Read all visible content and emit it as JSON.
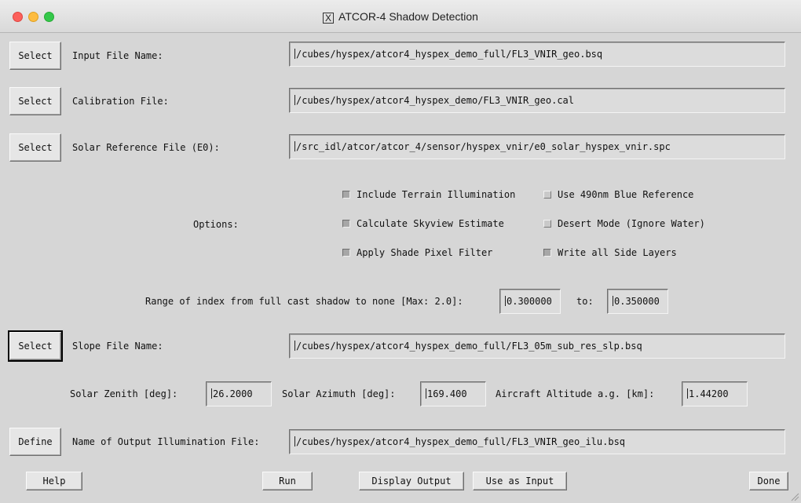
{
  "window": {
    "title": "ATCOR-4 Shadow Detection",
    "title_icon": "X"
  },
  "input_file": {
    "button_label": "Select",
    "label": "Input File Name:",
    "value": "/cubes/hyspex/atcor4_hyspex_demo_full/FL3_VNIR_geo.bsq"
  },
  "calibration_file": {
    "button_label": "Select",
    "label": "Calibration File:",
    "value": "/cubes/hyspex/atcor4_hyspex_demo/FL3_VNIR_geo.cal"
  },
  "solar_reference_file": {
    "button_label": "Select",
    "label": "Solar Reference File (E0):",
    "value": "/src_idl/atcor/atcor_4/sensor/hyspex_vnir/e0_solar_hyspex_vnir.spc"
  },
  "options": {
    "label": "Options:",
    "items": [
      {
        "label": "Include Terrain Illumination",
        "checked": true
      },
      {
        "label": "Use 490nm Blue Reference",
        "checked": false
      },
      {
        "label": "Calculate Skyview Estimate",
        "checked": true
      },
      {
        "label": "Desert Mode (Ignore Water)",
        "checked": false
      },
      {
        "label": "Apply Shade Pixel Filter",
        "checked": true
      },
      {
        "label": "Write all Side Layers",
        "checked": true
      }
    ]
  },
  "range": {
    "label": "Range of index from full cast shadow to none [Max: 2.0]:",
    "from_value": "0.300000",
    "to_label": "to:",
    "to_value": "0.350000"
  },
  "slope_file": {
    "button_label": "Select",
    "label": "Slope File Name:",
    "value": "/cubes/hyspex/atcor4_hyspex_demo_full/FL3_05m_sub_res_slp.bsq"
  },
  "geometry": {
    "zenith_label": "Solar Zenith [deg]:",
    "zenith_value": "26.2000",
    "azimuth_label": "Solar Azimuth [deg]:",
    "azimuth_value": "169.400",
    "altitude_label": "Aircraft Altitude a.g. [km]:",
    "altitude_value": "1.44200"
  },
  "output_file": {
    "button_label": "Define",
    "label": "Name of Output Illumination File:",
    "value": "/cubes/hyspex/atcor4_hyspex_demo_full/FL3_VNIR_geo_ilu.bsq"
  },
  "footer": {
    "help": "Help",
    "run": "Run",
    "display_output": "Display Output",
    "use_as_input": "Use as Input",
    "done": "Done"
  }
}
